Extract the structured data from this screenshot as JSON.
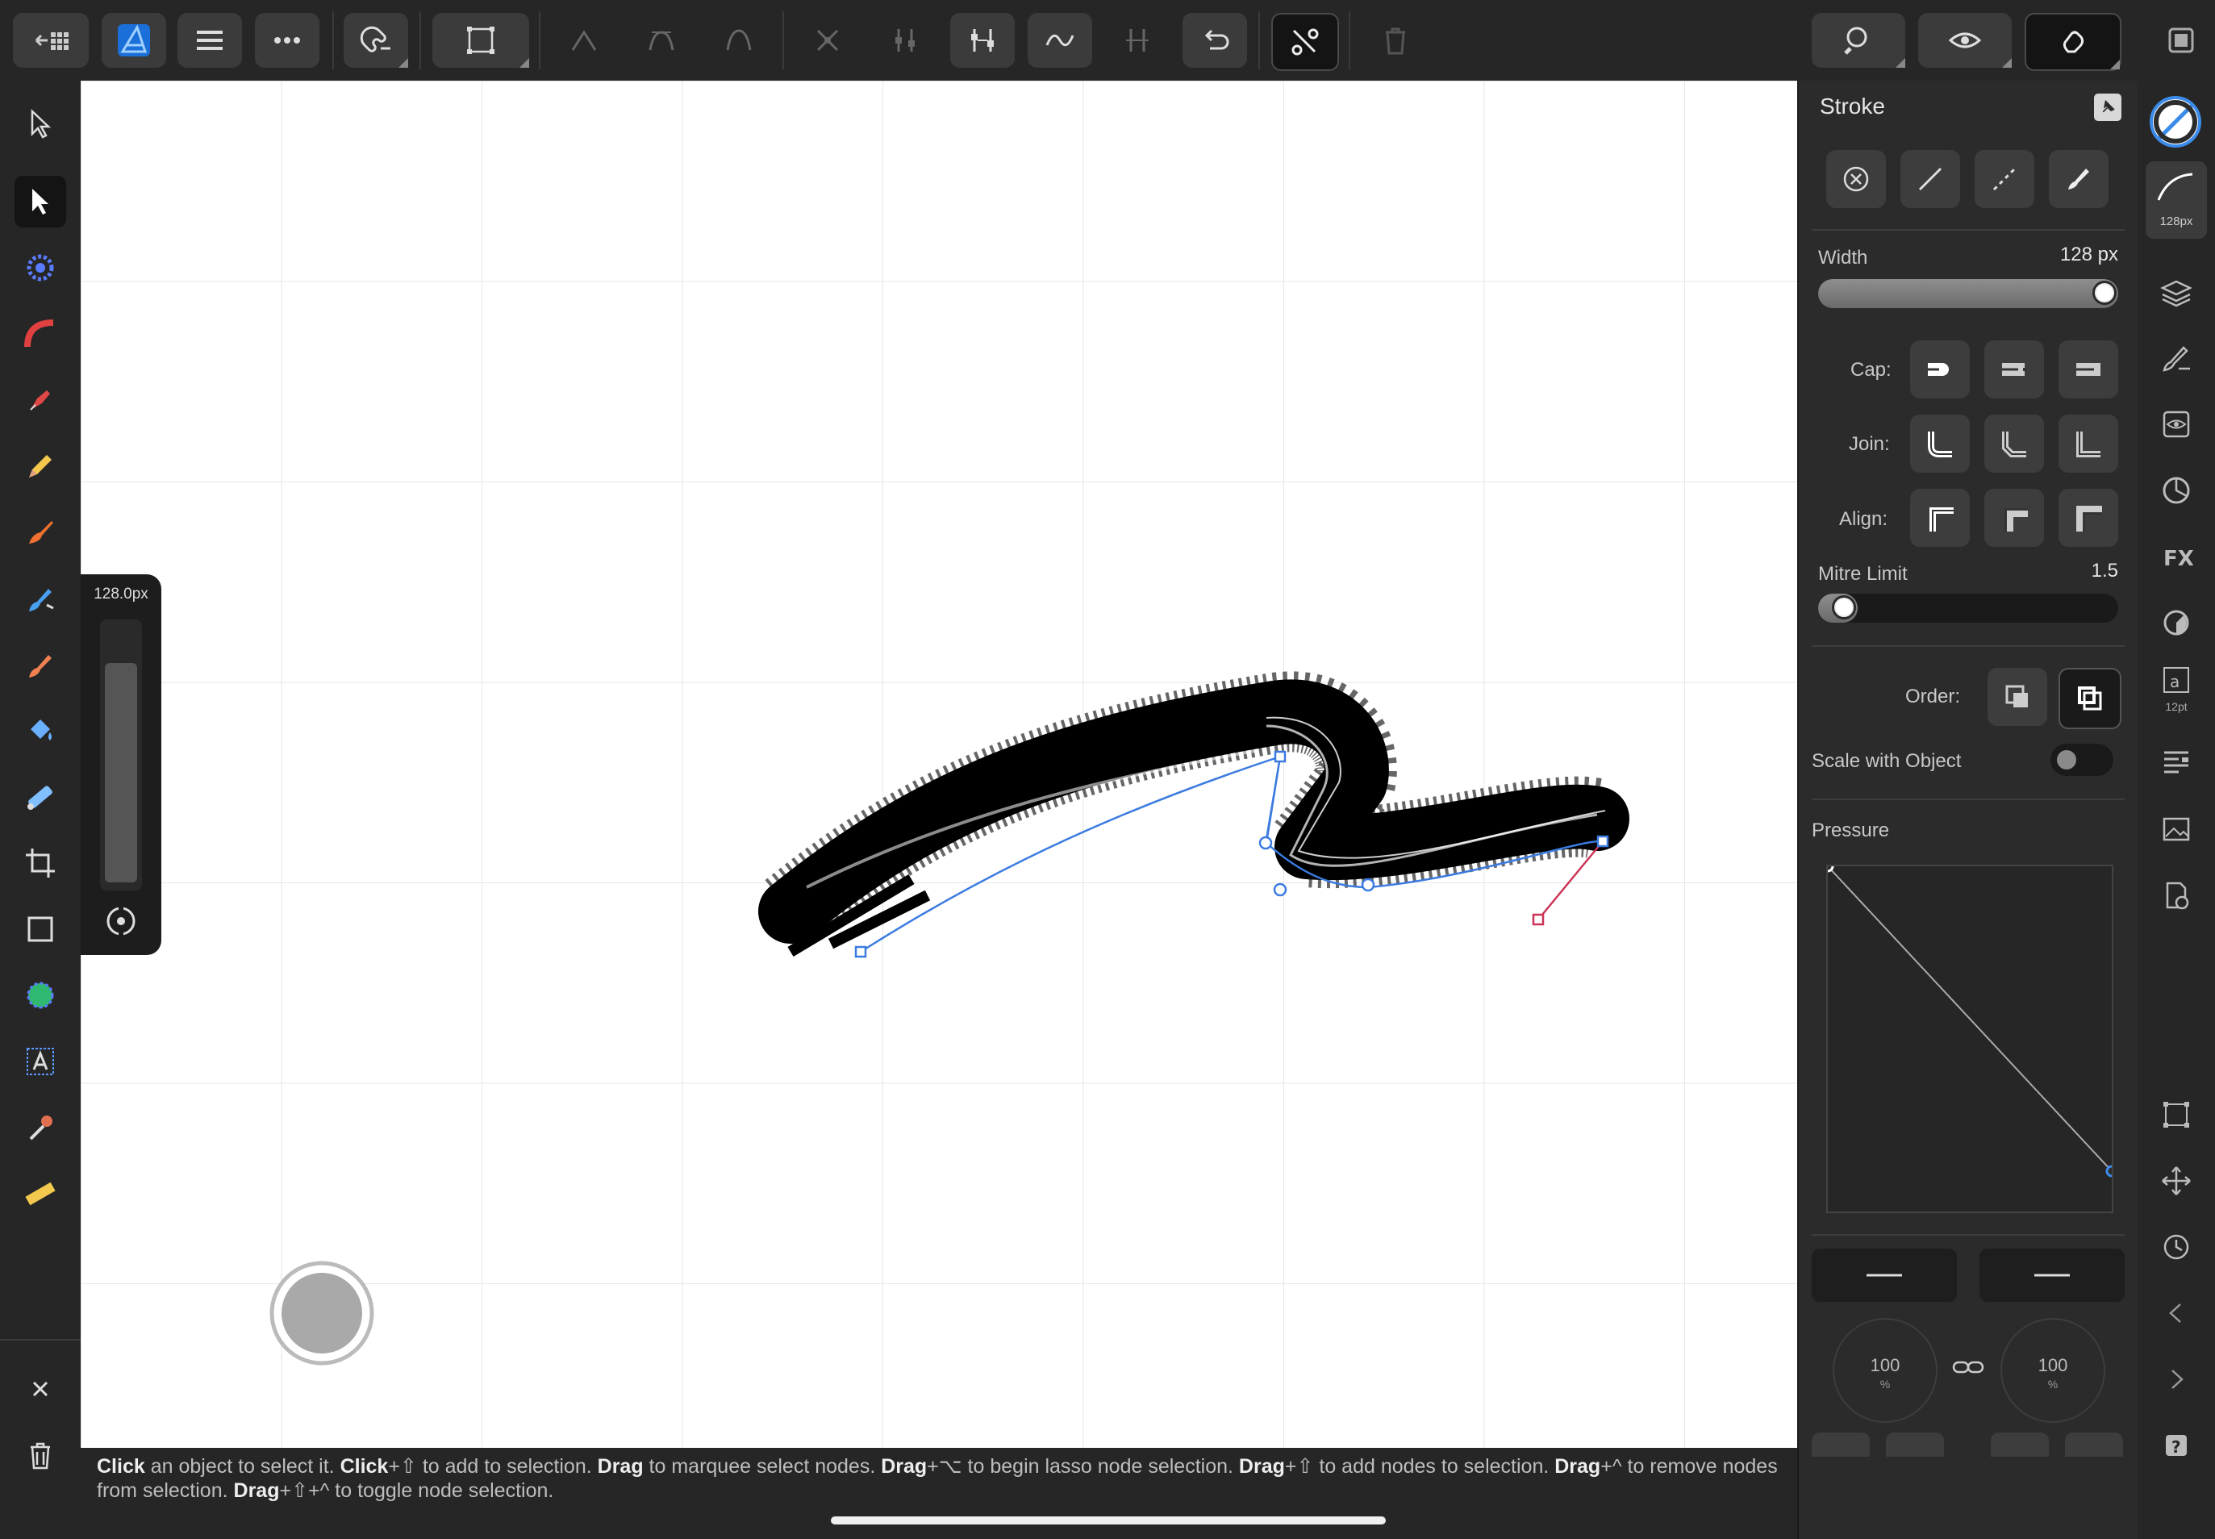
{
  "panel": {
    "title": "Stroke",
    "width_label": "Width",
    "width_value": "128 px",
    "width_fraction": 1.0,
    "cap_label": "Cap:",
    "join_label": "Join:",
    "align_label": "Align:",
    "mitre_label": "Mitre Limit",
    "mitre_value": "1.5",
    "mitre_fraction": 0.05,
    "order_label": "Order:",
    "scale_label": "Scale with Object",
    "scale_on": false,
    "pressure_label": "Pressure",
    "pressure_start_pct": "100",
    "pressure_end_pct": "100",
    "pct_unit": "%"
  },
  "right_rail": {
    "brush_size": "128px",
    "text_size": "12pt"
  },
  "left_popup": {
    "size": "128.0px"
  },
  "status": {
    "segments": [
      {
        "b": "Click",
        "t": " an object to select it. "
      },
      {
        "b": "Click",
        "t": "+⇧ to add to selection. "
      },
      {
        "b": "Drag",
        "t": " to marquee select nodes. "
      },
      {
        "b": "Drag",
        "t": "+⌥ to begin lasso node selection. "
      },
      {
        "b": "Drag",
        "t": "+⇧ to add nodes to selection. "
      },
      {
        "b": "Drag",
        "t": "+^ to remove nodes from selection. "
      },
      {
        "b": "Drag",
        "t": "+⇧+^ to toggle node selection."
      }
    ]
  },
  "colors": {
    "accent": "#3b8bea",
    "canvas": "#ffffff",
    "grid": "#e6e6e6",
    "stroke": "#000000",
    "node_handle_red": "#cc3355"
  }
}
